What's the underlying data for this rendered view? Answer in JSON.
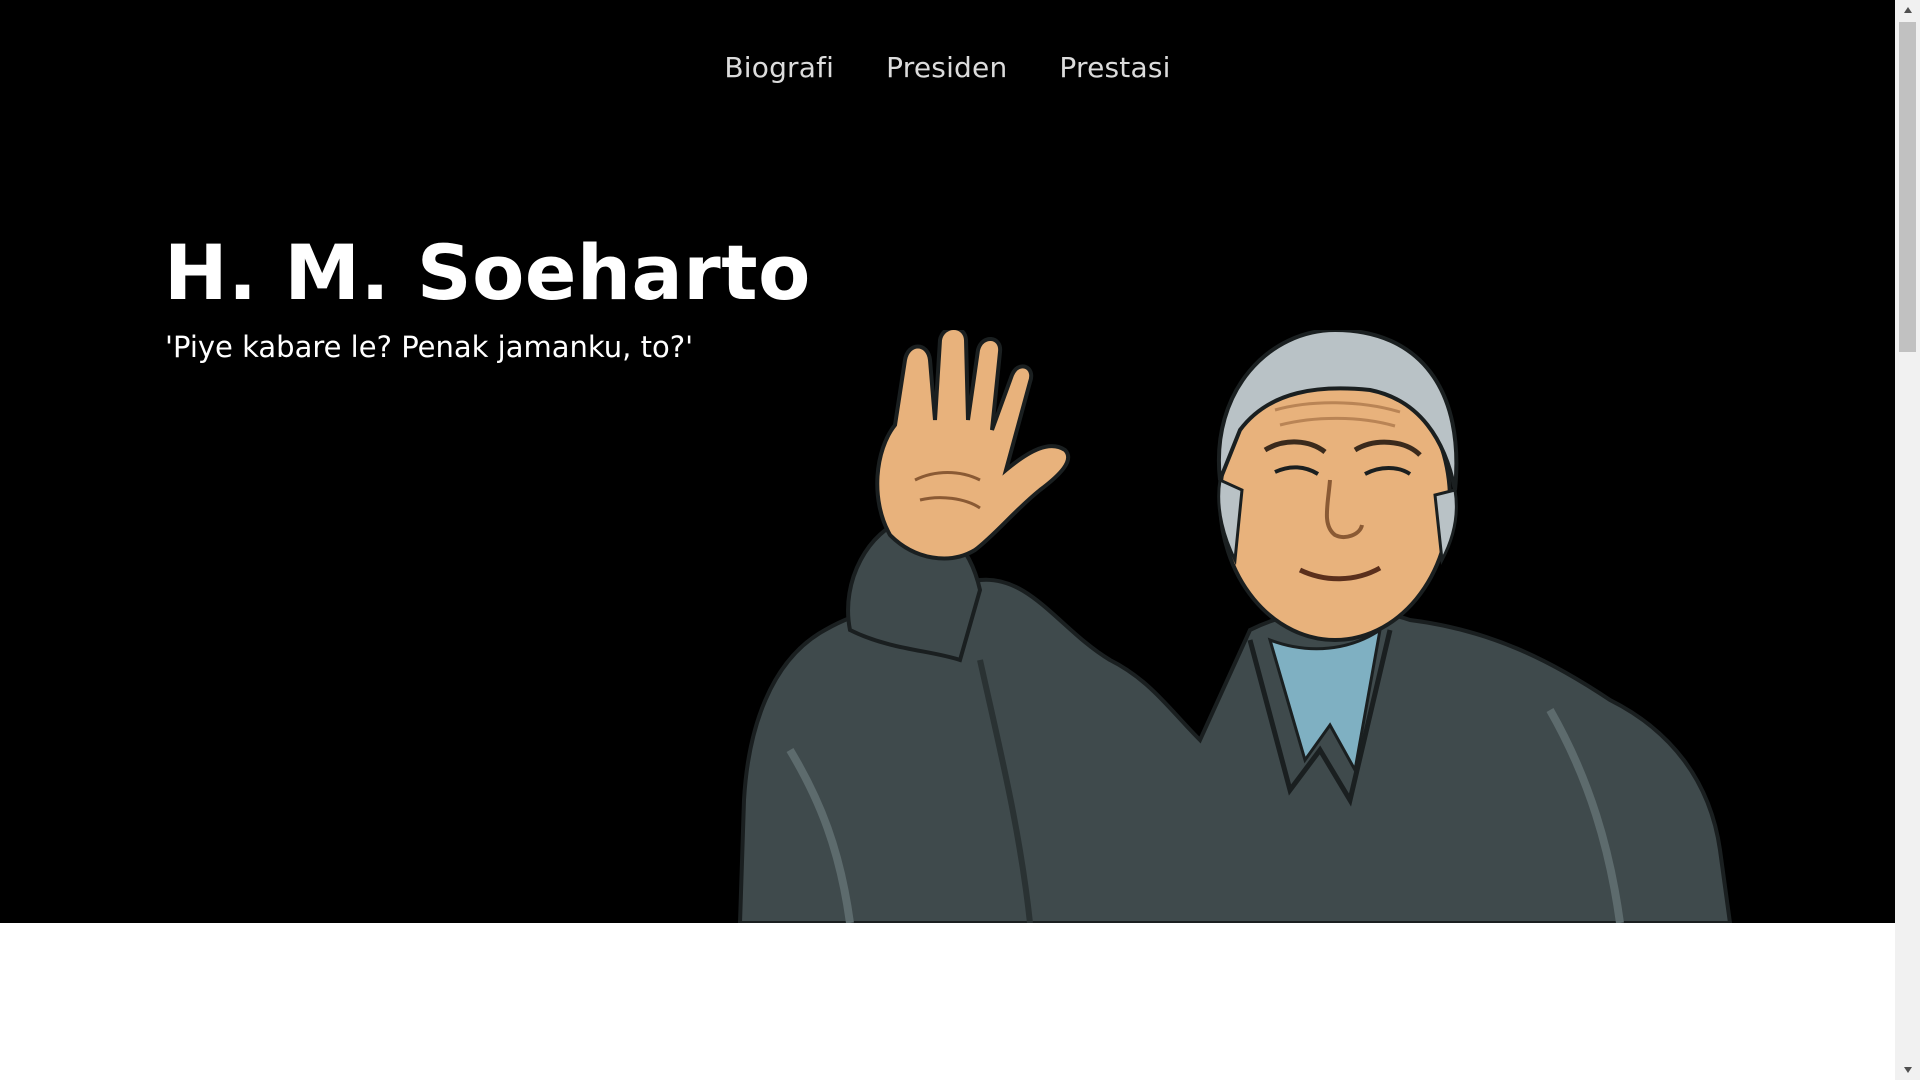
{
  "nav": {
    "items": [
      {
        "label": "Biografi"
      },
      {
        "label": "Presiden"
      },
      {
        "label": "Prestasi"
      }
    ]
  },
  "hero": {
    "title": "H. M. Soeharto",
    "subtitle": "'Piye kabare le? Penak jamanku, to?'"
  },
  "colors": {
    "hero_background": "#000000",
    "text": "#ffffff",
    "nav_text": "#dcdcdc",
    "jacket": "#3f4a4c",
    "skin": "#e8b27c",
    "hair": "#b9c2c6",
    "collar": "#7fb0c2"
  },
  "icons": {
    "scroll_up": "triangle-up",
    "scroll_down": "triangle-down"
  }
}
